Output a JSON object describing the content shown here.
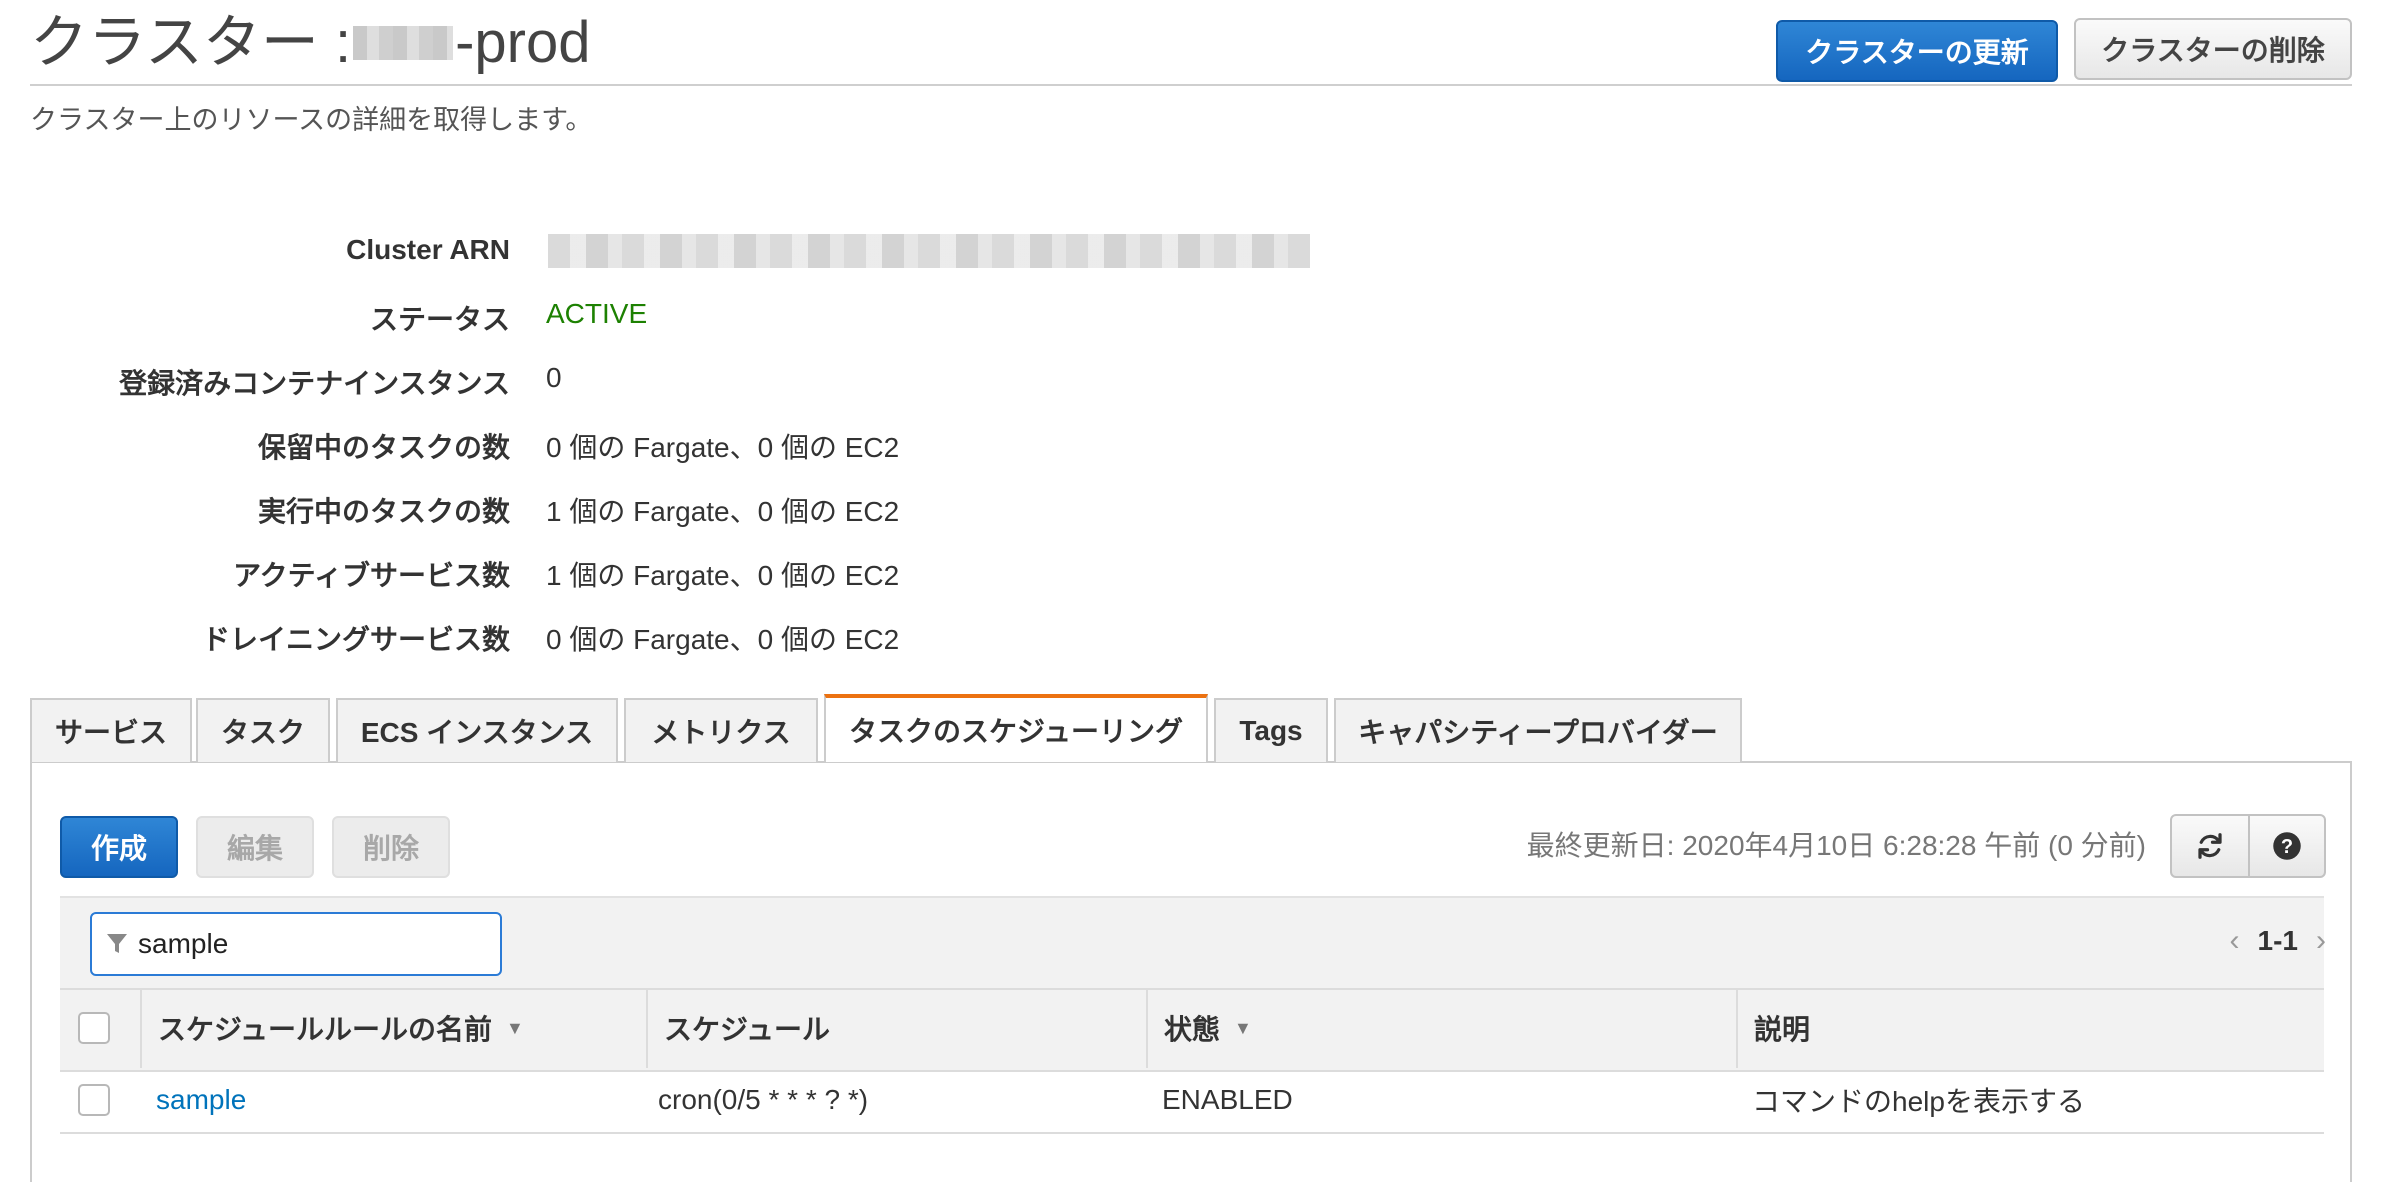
{
  "header": {
    "title_prefix": "クラスター : ",
    "title_suffix": "-prod",
    "subtitle": "クラスター上のリソースの詳細を取得します。",
    "update_button": "クラスターの更新",
    "delete_button": "クラスターの削除"
  },
  "details": [
    {
      "label": "Cluster ARN",
      "value": ""
    },
    {
      "label": "ステータス",
      "value": "ACTIVE"
    },
    {
      "label": "登録済みコンテナインスタンス",
      "value": "0"
    },
    {
      "label": "保留中のタスクの数",
      "value": "0 個の Fargate、0 個の EC2"
    },
    {
      "label": "実行中のタスクの数",
      "value": "1 個の Fargate、0 個の EC2"
    },
    {
      "label": "アクティブサービス数",
      "value": "1 個の Fargate、0 個の EC2"
    },
    {
      "label": "ドレイニングサービス数",
      "value": "0 個の Fargate、0 個の EC2"
    }
  ],
  "tabs": [
    {
      "label": "サービス"
    },
    {
      "label": "タスク"
    },
    {
      "label": "ECS インスタンス"
    },
    {
      "label": "メトリクス"
    },
    {
      "label": "タスクのスケジューリング",
      "selected": true
    },
    {
      "label": "Tags"
    },
    {
      "label": "キャパシティープロバイダー"
    }
  ],
  "toolbar": {
    "create": "作成",
    "edit": "編集",
    "delete": "削除",
    "last_updated": "最終更新日: 2020年4月10日 6:28:28 午前 (0 分前)"
  },
  "filter": {
    "value": "sample"
  },
  "pager": {
    "range": "1-1"
  },
  "table": {
    "columns": [
      "スケジュールルールの名前",
      "スケジュール",
      "状態",
      "説明"
    ],
    "rows": [
      {
        "name": "sample",
        "schedule": "cron(0/5 * * * ? *)",
        "state": "ENABLED",
        "description": "コマンドのhelpを表示する"
      }
    ]
  },
  "colors": {
    "primary": "#1566bf",
    "active_status": "#1d8102",
    "selected_tab_accent": "#ec7211",
    "link": "#0073bb"
  }
}
